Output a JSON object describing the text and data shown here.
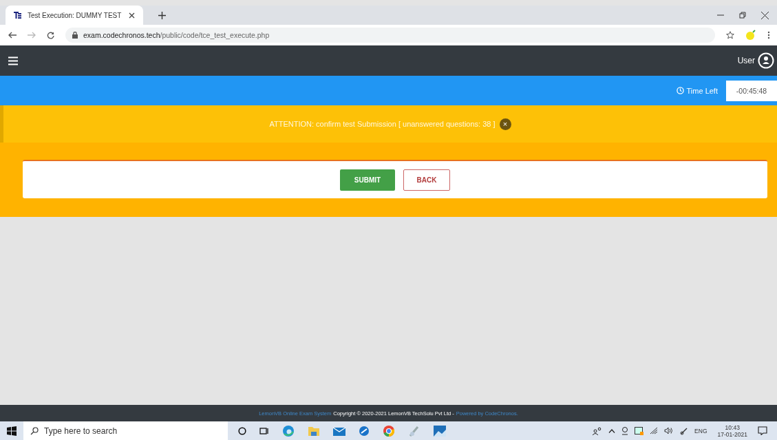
{
  "browser": {
    "tab": {
      "title": "Test Execution: DUMMY TEST",
      "selected": true
    },
    "url_host": "exam.codechronos.tech",
    "url_path": "/public/code/tce_test_execute.php"
  },
  "navbar": {
    "user": "User"
  },
  "timer": {
    "label": "Time Left",
    "value": "-00:45:48"
  },
  "alert": {
    "text": "ATTENTION: confirm test Submission [ unanswered questions: 38 ]",
    "close": "×"
  },
  "buttons": [
    {
      "label": "SUBMIT",
      "kind": "primary"
    },
    {
      "label": "BACK",
      "kind": "outline"
    }
  ],
  "footer": {
    "left_link": "LemonVB Online Exam System",
    "text": "Copyright © 2020-2021 LemonVB TechSolu Pvt Ltd -",
    "right_link": "Powered by CodeChronos."
  },
  "taskbar": {
    "search_placeholder": "Type here to search",
    "language": "ENG",
    "time": "10:43",
    "date": "17-01-2021"
  }
}
